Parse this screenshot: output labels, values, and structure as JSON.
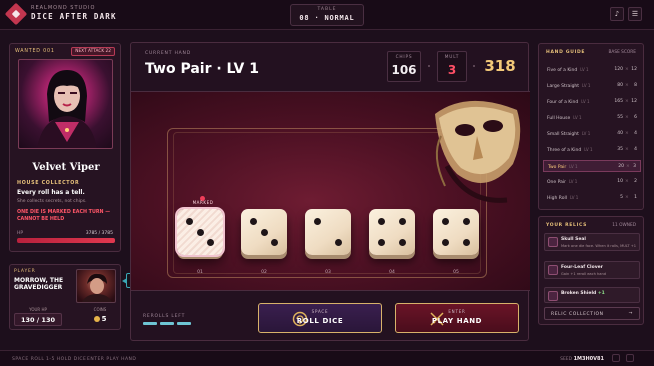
{
  "app": {
    "studio": "REALMOND STUDIO",
    "title": "DICE AFTER DARK"
  },
  "table": {
    "label": "TABLE",
    "value": "08 · NORMAL"
  },
  "topbar": {
    "music_icon": "♪",
    "menu_icon": "☰"
  },
  "enemy": {
    "wanted": "WANTED 001",
    "next_attack": "NEXT ATTACK 22",
    "name": "Velvet Viper",
    "house": "HOUSE COLLECTOR",
    "ability": "Every roll has a tell.",
    "ability_sub": "She collects secrets, not chips.",
    "warning": "ONE DIE IS MARKED EACH TURN — CANNOT BE HELD",
    "hp_label": "HP",
    "hp_value": "3785 / 3785",
    "hp_fraction": 1.0
  },
  "player": {
    "label": "PLAYER",
    "name": "MORROW, THE GRAVEDIGGER",
    "hp_label": "YOUR HP",
    "hp_value": "130 / 130",
    "coins_label": "COINS",
    "coins_value": "5"
  },
  "tooltip": "You can't reroll what's buried.",
  "hand": {
    "label": "CURRENT HAND",
    "name": "Two Pair · LV 1",
    "chips_label": "CHIPS",
    "chips": "106",
    "mult_label": "MULT",
    "mult": "3",
    "score": "318"
  },
  "dice": [
    {
      "value": 3,
      "label": "01",
      "marked": true
    },
    {
      "value": 3,
      "label": "02",
      "marked": false
    },
    {
      "value": 2,
      "label": "03",
      "marked": false
    },
    {
      "value": 4,
      "label": "04",
      "marked": false
    },
    {
      "value": 4,
      "label": "05",
      "marked": false
    }
  ],
  "marked_label": "MARKED",
  "rerolls": {
    "label": "REROLLS LEFT",
    "count": 3
  },
  "buttons": {
    "roll_key": "SPACE",
    "roll_label": "ROLL DICE",
    "play_key": "ENTER",
    "play_label": "PLAY HAND"
  },
  "guide": {
    "title": "HAND GUIDE",
    "subtitle": "BASE SCORE",
    "rows": [
      {
        "name": "Five of a Kind",
        "lv": "LV 1",
        "chips": "120",
        "mult": "12",
        "active": false
      },
      {
        "name": "Large Straight",
        "lv": "LV 1",
        "chips": "80",
        "mult": "8",
        "active": false
      },
      {
        "name": "Four of a Kind",
        "lv": "LV 1",
        "chips": "165",
        "mult": "12",
        "active": false
      },
      {
        "name": "Full House",
        "lv": "LV 1",
        "chips": "55",
        "mult": "6",
        "active": false
      },
      {
        "name": "Small Straight",
        "lv": "LV 1",
        "chips": "40",
        "mult": "4",
        "active": false
      },
      {
        "name": "Three of a Kind",
        "lv": "LV 1",
        "chips": "35",
        "mult": "4",
        "active": false
      },
      {
        "name": "Two Pair",
        "lv": "LV 1",
        "chips": "20",
        "mult": "3",
        "active": true
      },
      {
        "name": "One Pair",
        "lv": "LV 1",
        "chips": "10",
        "mult": "2",
        "active": false
      },
      {
        "name": "High Roll",
        "lv": "LV 1",
        "chips": "5",
        "mult": "1",
        "active": false
      }
    ]
  },
  "relics": {
    "title": "YOUR RELICS",
    "owned": "11 OWNED",
    "items": [
      {
        "name": "Skull Seal",
        "desc": "Mark one die face. When it rolls, MULT +1"
      },
      {
        "name": "Four-Leaf Clover",
        "desc": "Gain +1 reroll each hand"
      },
      {
        "name": "Broken Shield",
        "badge": "+1",
        "desc": ""
      }
    ],
    "collection_label": "RELIC COLLECTION",
    "collection_arrow": "→"
  },
  "footer": {
    "hint1": "SPACE ROLL",
    "hint2": "1-5 HOLD DICE",
    "hint3": "ENTER PLAY HAND",
    "seed_label": "SEED",
    "seed_value": "1M3H0V81"
  },
  "colors": {
    "accent": "#c2364f",
    "gold": "#f3c979",
    "mult": "#ff4f66",
    "cyan": "#6ec5d4"
  }
}
